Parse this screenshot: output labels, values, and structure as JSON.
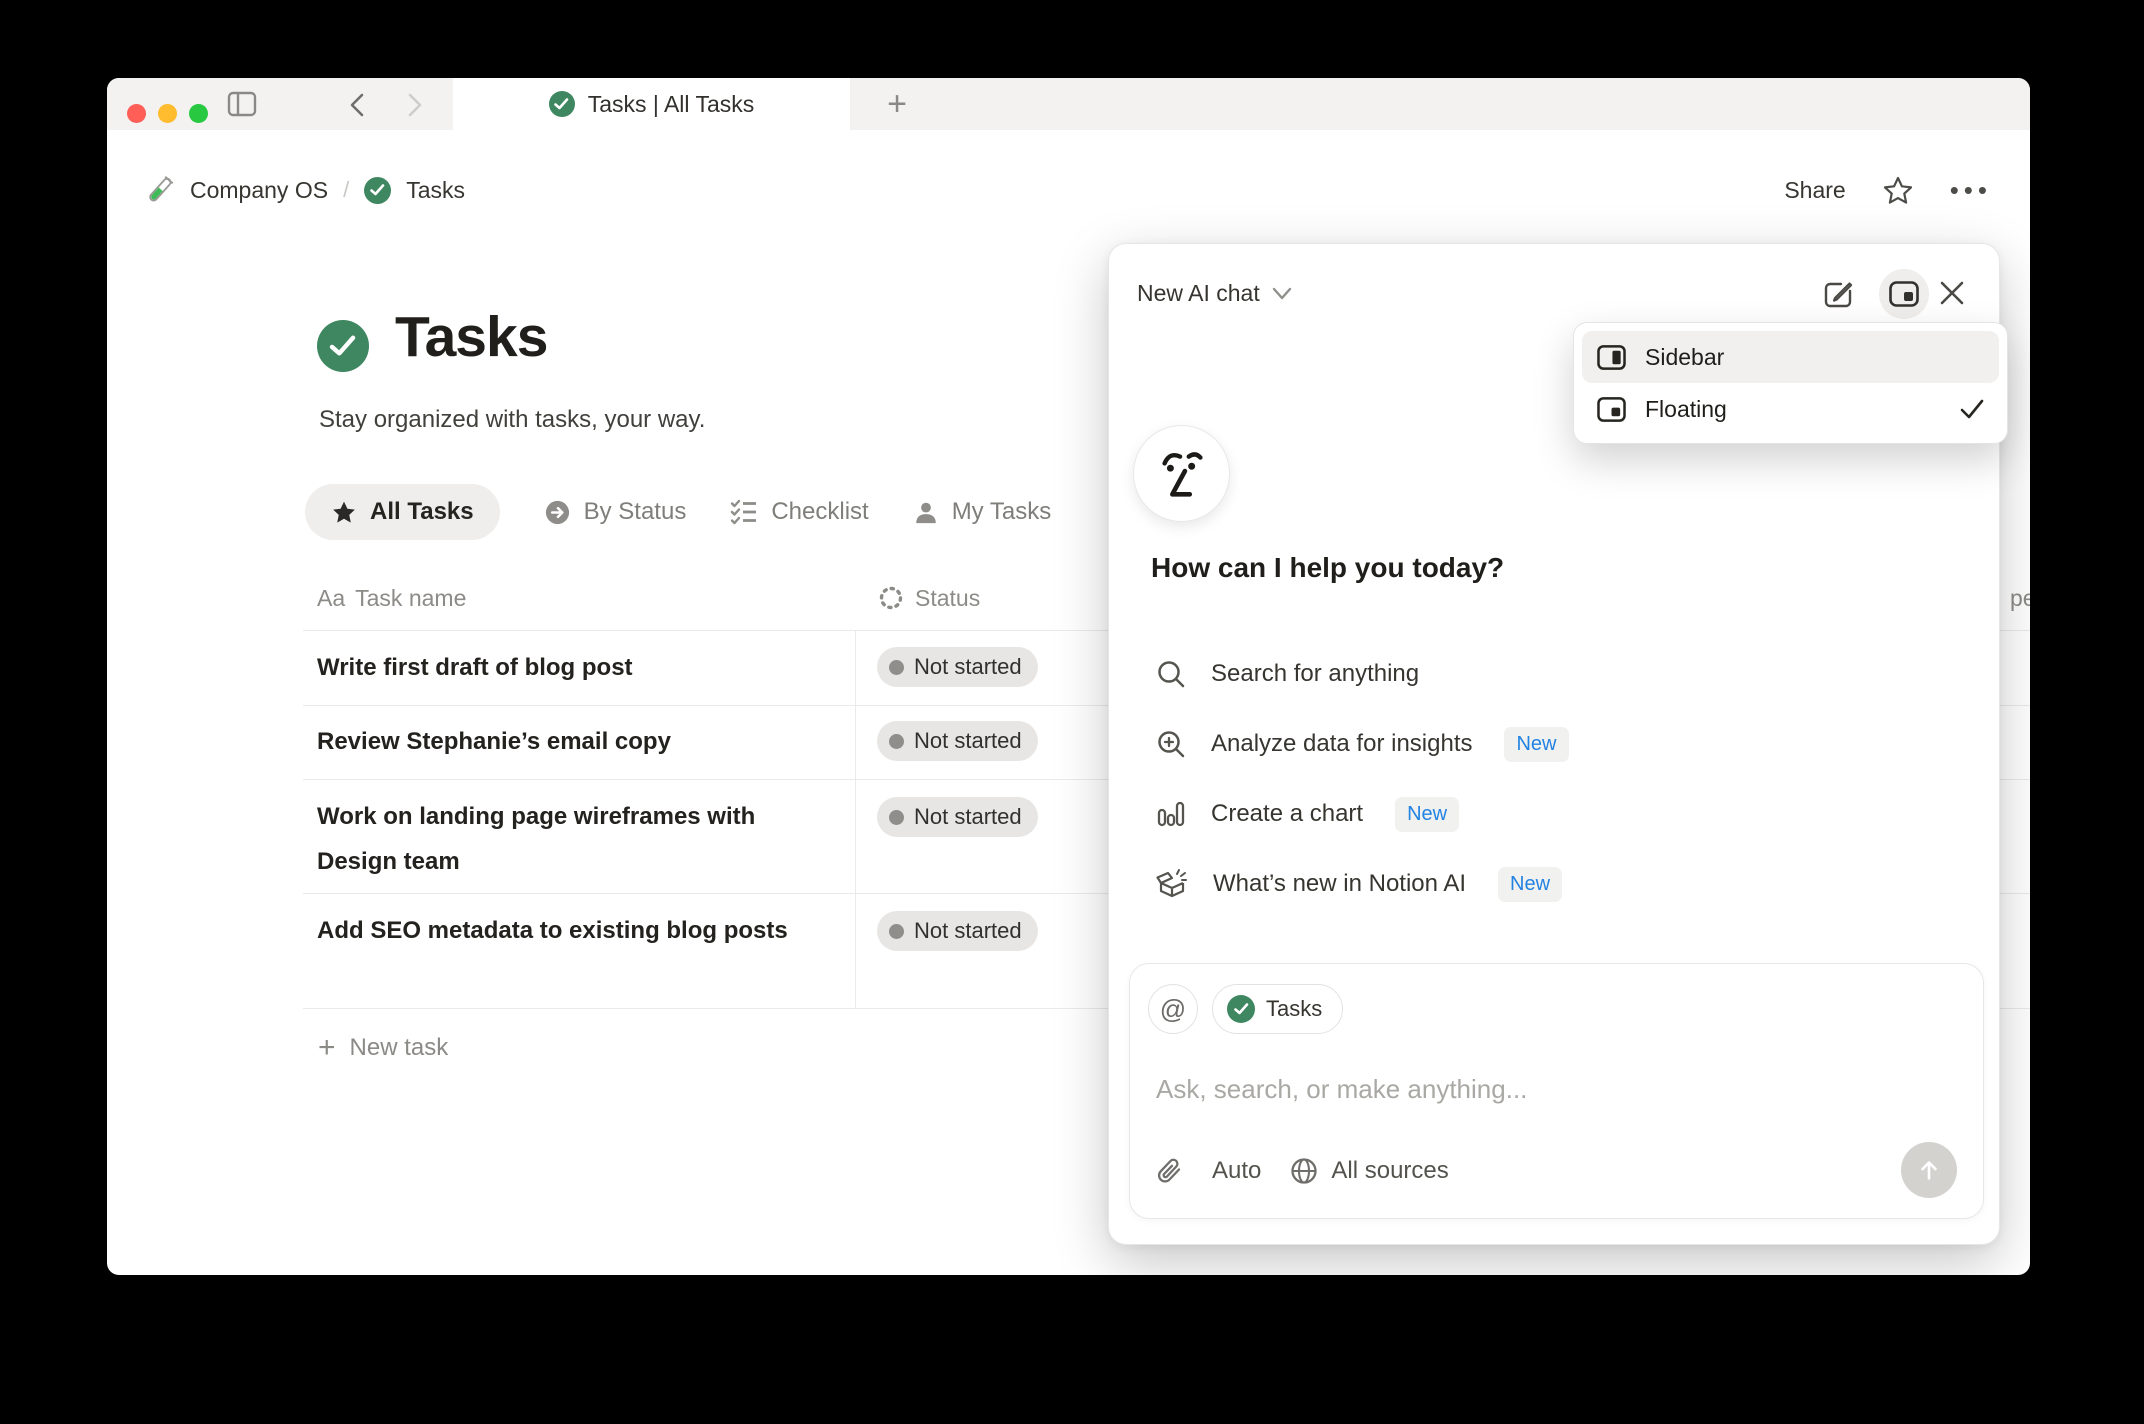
{
  "colors": {
    "accent_green": "#3e8760",
    "badge_blue": "#2383e2",
    "tabbar_gray": "#f3f2f1",
    "pill_gray": "#e7e6e4",
    "traffic_red": "#ff5f57",
    "traffic_yellow": "#febc2e",
    "traffic_green": "#28c840"
  },
  "window": {
    "tab_bar": {
      "tab_title": "Tasks | All Tasks",
      "new_tab_label": "+"
    },
    "breadcrumb": {
      "workspace": "Company OS",
      "separator": "/",
      "page": "Tasks"
    },
    "top_actions": {
      "share_label": "Share",
      "more_label": "•••"
    },
    "page": {
      "title": "Tasks",
      "subtitle": "Stay organized with tasks, your way.",
      "views": [
        {
          "label": "All Tasks",
          "icon": "star-icon",
          "active": true
        },
        {
          "label": "By Status",
          "icon": "arrow-circle-icon",
          "active": false
        },
        {
          "label": "Checklist",
          "icon": "checklist-icon",
          "active": false
        },
        {
          "label": "My Tasks",
          "icon": "person-icon",
          "active": false
        }
      ],
      "table": {
        "name_column": {
          "icon_label": "Aa",
          "label": "Task name"
        },
        "status_column": {
          "label": "Status"
        },
        "partial_column_label": "pe",
        "rows": [
          {
            "name": "Write first draft of blog post",
            "status": "Not started"
          },
          {
            "name": "Review Stephanie’s email copy",
            "status": "Not started"
          },
          {
            "name": "Work on landing page wireframes with Design team",
            "status": "Not started"
          },
          {
            "name": "Add SEO metadata to existing blog posts",
            "status": "Not started"
          }
        ],
        "new_row_label": "New task",
        "new_row_plus": "+"
      }
    }
  },
  "ai_panel": {
    "header": {
      "title": "New AI chat"
    },
    "greeting": "How can I help you today?",
    "suggestions": [
      {
        "label": "Search for anything"
      },
      {
        "label": "Analyze data for insights",
        "badge": "New"
      },
      {
        "label": "Create a chart",
        "badge": "New"
      },
      {
        "label": "What’s new in Notion AI",
        "badge": "New"
      }
    ],
    "composer": {
      "at_label": "@",
      "context_chip": "Tasks",
      "placeholder": "Ask, search, or make anything...",
      "mode_label": "Auto",
      "sources_label": "All sources"
    }
  },
  "view_menu": {
    "items": [
      {
        "label": "Sidebar",
        "checked": false
      },
      {
        "label": "Floating",
        "checked": true
      }
    ]
  }
}
